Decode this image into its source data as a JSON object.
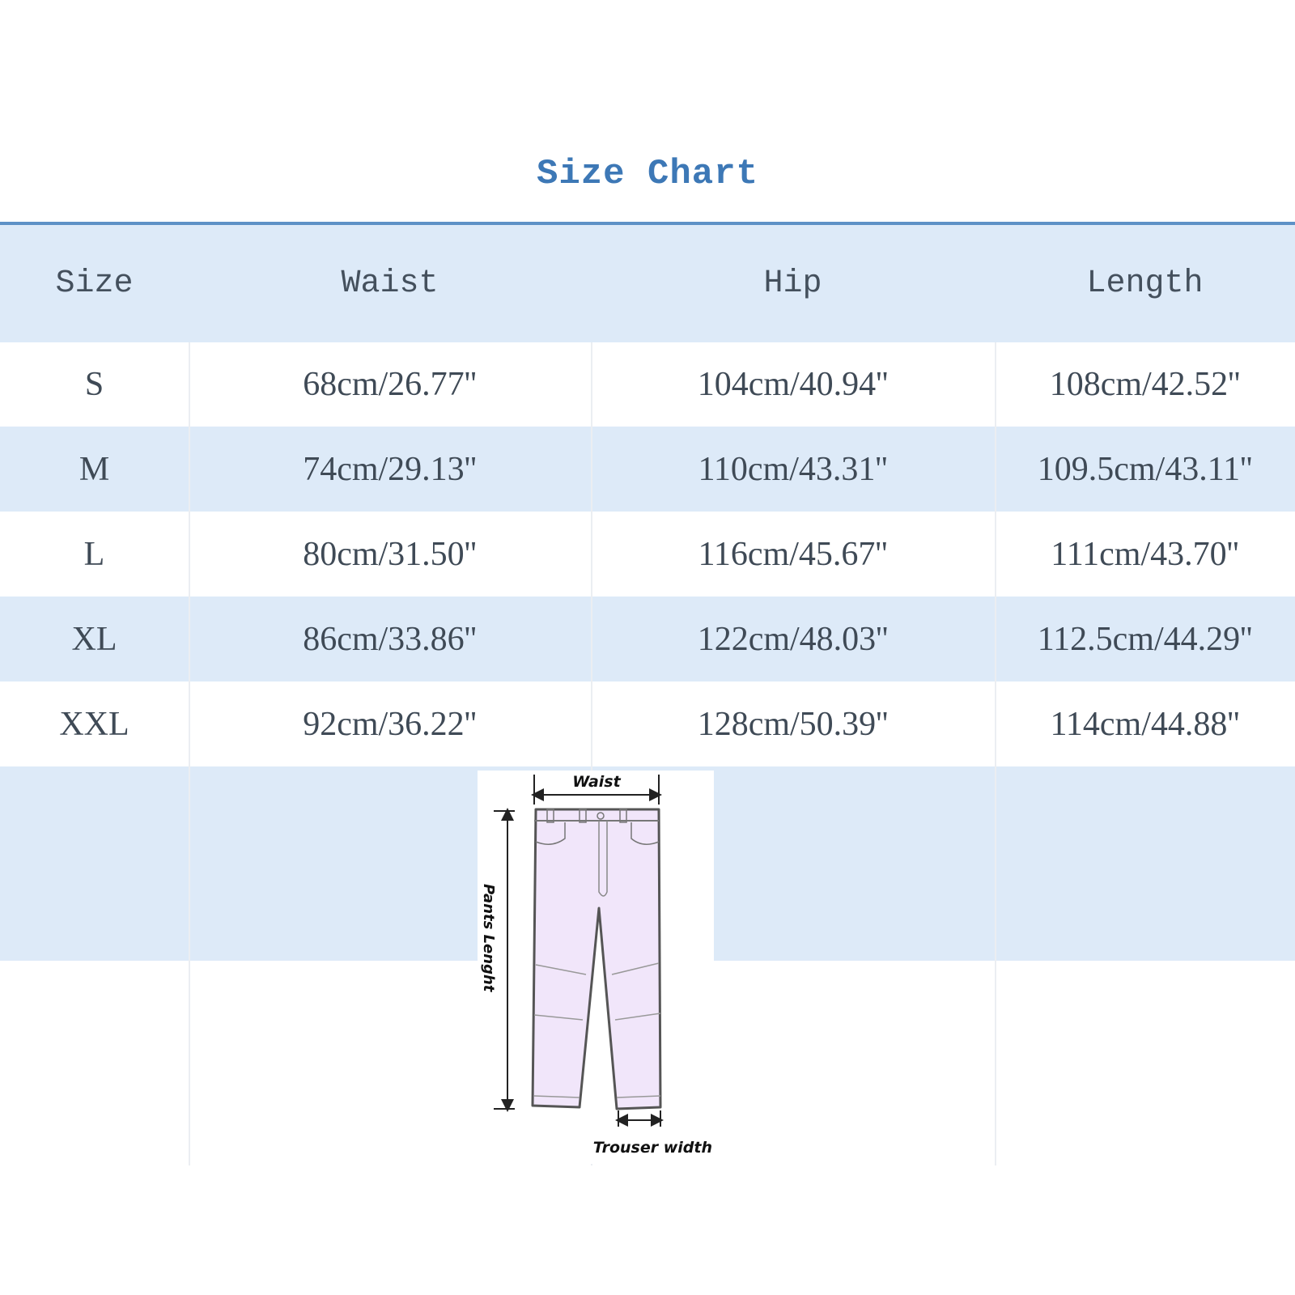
{
  "title": "Size Chart",
  "colors": {
    "title": "#3d78b6",
    "rule": "#5d91c6",
    "band": "#ddeaf8",
    "text": "#3f4a56",
    "pants_fill": "#f1e6fa",
    "pants_stroke": "#555555"
  },
  "table": {
    "headers": [
      "Size",
      "Waist",
      "Hip",
      "Length"
    ],
    "rows": [
      [
        "S",
        "68cm/26.77''",
        "104cm/40.94''",
        "108cm/42.52''"
      ],
      [
        "M",
        "74cm/29.13''",
        "110cm/43.31''",
        "109.5cm/43.11''"
      ],
      [
        "L",
        "80cm/31.50''",
        "116cm/45.67''",
        "111cm/43.70''"
      ],
      [
        "XL",
        "86cm/33.86''",
        "122cm/48.03''",
        "112.5cm/44.29''"
      ],
      [
        "XXL",
        "92cm/36.22''",
        "128cm/50.39''",
        "114cm/44.88''"
      ]
    ]
  },
  "diagram": {
    "waist_label": "Waist",
    "length_label": "Pants Lenght",
    "width_label": "Trouser width"
  }
}
